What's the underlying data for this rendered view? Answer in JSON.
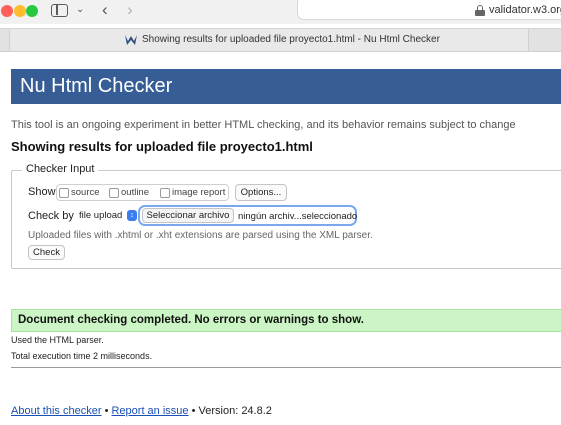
{
  "browser": {
    "url": "validator.w3.org",
    "tab_title": "Showing results for uploaded file proyecto1.html - Nu Html Checker"
  },
  "page": {
    "banner_title": "Nu Html Checker",
    "intro": "This tool is an ongoing experiment in better HTML checking, and its behavior remains subject to change",
    "results_heading": "Showing results for uploaded file proyecto1.html",
    "form": {
      "legend": "Checker Input",
      "show_label": "Show",
      "show_options": [
        {
          "label": "source",
          "checked": false
        },
        {
          "label": "outline",
          "checked": false
        },
        {
          "label": "image report",
          "checked": false
        }
      ],
      "options_button": "Options...",
      "check_by_label": "Check by",
      "method_selected": "file upload",
      "file_button": "Seleccionar archivo",
      "file_status": "ningún archiv...seleccionado",
      "parser_note": "Uploaded files with .xhtml or .xht extensions are parsed using the XML parser.",
      "check_button": "Check"
    },
    "success_message": "Document checking completed. No errors or warnings to show.",
    "info_parser": "Used the HTML parser.",
    "info_time": "Total execution time 2 milliseconds.",
    "footer": {
      "about_link": "About this checker",
      "separator": "•",
      "report_link": "Report an issue",
      "version_text": "Version: 24.8.2"
    }
  },
  "colors": {
    "banner": "#365d95",
    "success_bg": "#ccf5c5",
    "link": "#1a4fb5"
  }
}
